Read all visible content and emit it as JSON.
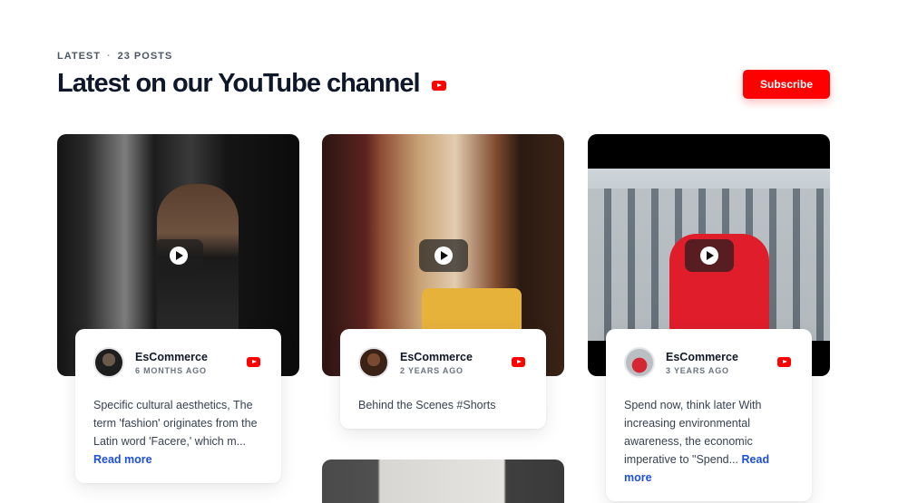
{
  "header": {
    "eyebrow_label": "LATEST",
    "eyebrow_count": "23 POSTS",
    "title": "Latest on our YouTube channel",
    "subscribe_label": "Subscribe"
  },
  "colors": {
    "accent": "#ff0000",
    "link": "#1d4ed8",
    "heading": "#0f172a"
  },
  "icons": {
    "channel": "youtube-icon",
    "play": "play-icon"
  },
  "posts": [
    {
      "author": "EsCommerce",
      "time": "6 MONTHS AGO",
      "excerpt": "Specific cultural aesthetics, The term 'fashion' originates from the Latin word 'Facere,' which m...",
      "read_more": "Read more"
    },
    {
      "author": "EsCommerce",
      "time": "2 YEARS AGO",
      "excerpt": "Behind the Scenes #Shorts"
    },
    {
      "author": "EsCommerce",
      "time": "3 YEARS AGO",
      "excerpt": "Spend now, think later With increasing environmental awareness, the economic imperative to \"Spend...",
      "read_more": "Read more"
    }
  ]
}
